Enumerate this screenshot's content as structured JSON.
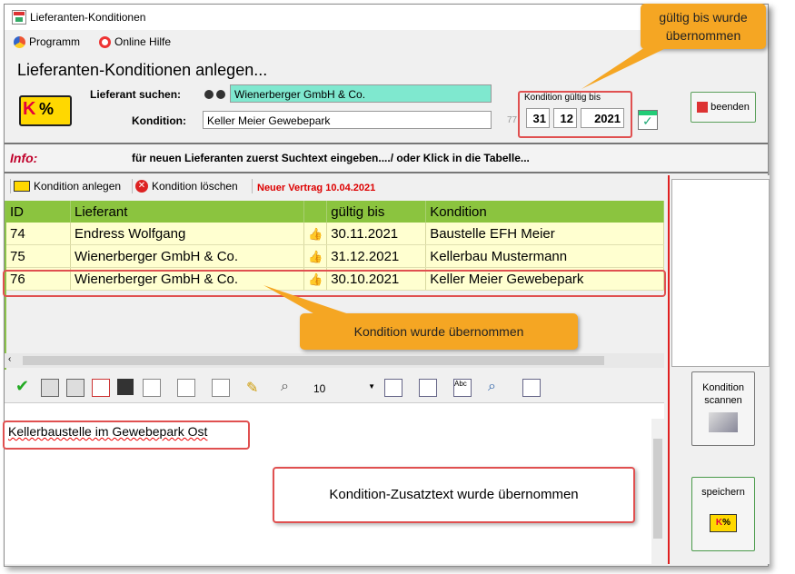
{
  "window": {
    "title": "Lieferanten-Konditionen"
  },
  "menu": [
    {
      "label": "Programm",
      "icon": "programm-icon"
    },
    {
      "label": "Online Hilfe",
      "icon": "help-lifebuoy-icon"
    }
  ],
  "header": {
    "title": "Lieferanten-Konditionen anlegen...",
    "supplier_search_label": "Lieferant suchen:",
    "supplier_value": "Wienerberger GmbH & Co.",
    "condition_label": "Kondition:",
    "condition_value": "Keller Meier Gewebepark",
    "hint_number": "77",
    "valid_until_label": "Kondition gültig bis",
    "valid_day": "31",
    "valid_month": "12",
    "valid_year": "2021",
    "exit_button": "beenden"
  },
  "info": {
    "label": "Info:",
    "text": "für neuen Lieferanten zuerst Suchtext eingeben..../ oder Klick in die Tabelle..."
  },
  "toolbar": {
    "add_label": "Kondition anlegen",
    "delete_label": "Kondition löschen",
    "new_contract": "Neuer Vertrag 10.04.2021"
  },
  "table": {
    "columns": [
      "ID",
      "Lieferant",
      "",
      "gültig bis",
      "Kondition"
    ],
    "rows": [
      {
        "id": "74",
        "supplier": "Endress Wolfgang",
        "valid": "30.11.2021",
        "condition": "Baustelle EFH Meier"
      },
      {
        "id": "75",
        "supplier": "Wienerberger GmbH & Co.",
        "valid": "31.12.2021",
        "condition": "Kellerbau Mustermann"
      },
      {
        "id": "76",
        "supplier": "Wienerberger GmbH & Co.",
        "valid": "30.10.2021",
        "condition": "Keller Meier Gewebepark"
      }
    ]
  },
  "editor": {
    "font_size": "10",
    "text": "Kellerbaustelle im Gewebepark Ost"
  },
  "right": {
    "scan_button": "Kondition scannen",
    "save_button": "speichern"
  },
  "callouts": {
    "valid_taken": "gültig bis wurde übernommen",
    "condition_taken": "Kondition wurde übernommen",
    "extra_text_taken": "Kondition-Zusatztext wurde übernommen"
  },
  "colors": {
    "accent_green": "#8bc43f",
    "row_yellow": "#ffffd0",
    "callout_orange": "#f5a623",
    "annot_red": "#e05050"
  }
}
